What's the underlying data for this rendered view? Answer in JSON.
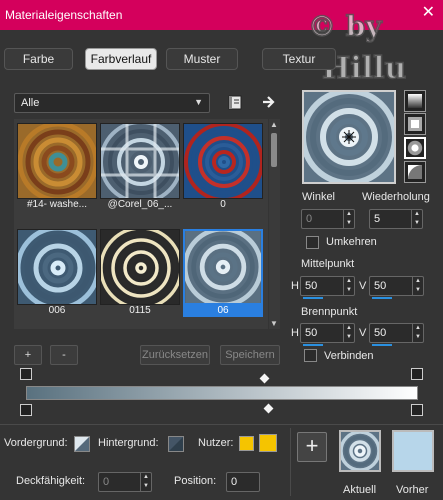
{
  "window": {
    "title": "Materialeigenschaften",
    "close_glyph": "✕",
    "watermark": "© by Hillu"
  },
  "tabs": [
    {
      "label": "Farbe",
      "active": false
    },
    {
      "label": "Farbverlauf",
      "active": true
    },
    {
      "label": "Muster",
      "active": false
    },
    {
      "label": "Textur",
      "active": false
    }
  ],
  "category_select": {
    "value": "Alle"
  },
  "gallery": {
    "thumbs": [
      {
        "caption": "#14- washe...",
        "style": "gold"
      },
      {
        "caption": "@Corel_06_...",
        "style": "steel-grid"
      },
      {
        "caption": "0",
        "style": "red-blue"
      },
      {
        "caption": "006",
        "style": "blue-light"
      },
      {
        "caption": "0115",
        "style": "cream-dark"
      },
      {
        "caption": "06",
        "style": "blue-steel",
        "selected": true
      }
    ]
  },
  "buttons": {
    "add": "+",
    "remove": "-",
    "reset": "Zurücksetzen",
    "save": "Speichern"
  },
  "angle": {
    "label": "Winkel",
    "value": "0"
  },
  "repeat": {
    "label": "Wiederholung",
    "value": "5"
  },
  "invert": {
    "label": "Umkehren"
  },
  "center": {
    "label": "Mittelpunkt",
    "h_label": "H",
    "h": "50",
    "v_label": "V",
    "v": "50"
  },
  "focus": {
    "label": "Brennpunkt",
    "h_label": "H",
    "h": "50",
    "v_label": "V",
    "v": "50"
  },
  "link": {
    "label": "Verbinden"
  },
  "stops": {
    "foreground": {
      "label": "Vordergrund:"
    },
    "background": {
      "label": "Hintergrund:"
    },
    "user": {
      "label": "Nutzer:",
      "color": "#f5c400"
    },
    "opacity": {
      "label": "Deckfähigkeit:",
      "value": "0"
    },
    "position": {
      "label": "Position:",
      "value": "0"
    }
  },
  "bottom": {
    "current_label": "Aktuell",
    "previous_label": "Vorher",
    "add_glyph": "+"
  },
  "colors": {
    "titlebar": "#d4005c",
    "selection": "#2a7fe0",
    "gradient_start": "#59717f",
    "gradient_end": "#ffffff",
    "previous": "#b7d6ea"
  }
}
